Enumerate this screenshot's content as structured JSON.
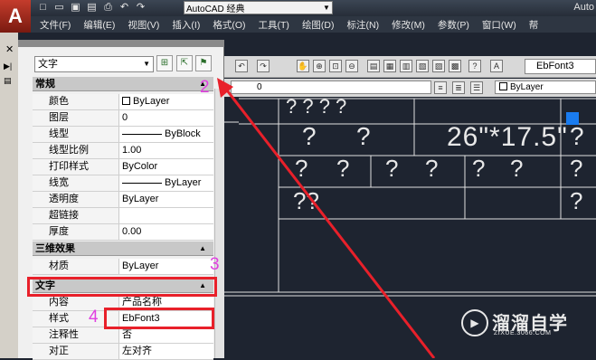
{
  "titlebar": {
    "logo": "A",
    "workspace": "AutoCAD 经典",
    "app_name": "Auto",
    "qa_icons": [
      "new-icon",
      "open-icon",
      "save-icon",
      "save-as-icon",
      "print-icon",
      "undo-icon",
      "redo-icon"
    ],
    "qa_glyphs": [
      "□",
      "▭",
      "▣",
      "▤",
      "⎙",
      "↶",
      "↷"
    ]
  },
  "menu": [
    "文件(F)",
    "编辑(E)",
    "视图(V)",
    "插入(I)",
    "格式(O)",
    "工具(T)",
    "绘图(D)",
    "标注(N)",
    "修改(M)",
    "参数(P)",
    "窗口(W)",
    "帮"
  ],
  "side": {
    "close": "✕",
    "pin": "▶|",
    "caption": "▤"
  },
  "toolbar": {
    "font_label": "EbFont3",
    "layer_value": "0",
    "bylayer": "ByLayer"
  },
  "properties": {
    "object_type": "文字",
    "section_general": "常规",
    "general_rows": [
      {
        "name": "颜色",
        "value": "ByLayer",
        "kind": "color"
      },
      {
        "name": "图层",
        "value": "0",
        "kind": "text"
      },
      {
        "name": "线型",
        "value": "ByBlock",
        "kind": "line"
      },
      {
        "name": "线型比例",
        "value": "1.00",
        "kind": "text"
      },
      {
        "name": "打印样式",
        "value": "ByColor",
        "kind": "text"
      },
      {
        "name": "线宽",
        "value": "ByLayer",
        "kind": "line"
      },
      {
        "name": "透明度",
        "value": "ByLayer",
        "kind": "text"
      },
      {
        "name": "超链接",
        "value": "",
        "kind": "text"
      },
      {
        "name": "厚度",
        "value": "0.00",
        "kind": "text"
      }
    ],
    "section_3d": "三维效果",
    "rows_3d": [
      {
        "name": "材质",
        "value": "ByLayer"
      }
    ],
    "section_text": "文字",
    "text_rows": [
      {
        "name": "内容",
        "value": "产品名称"
      },
      {
        "name": "样式",
        "value": "EbFont3"
      },
      {
        "name": "注释性",
        "value": "否"
      },
      {
        "name": "对正",
        "value": "左对齐"
      }
    ]
  },
  "annotations": {
    "n2": "2",
    "n3": "3",
    "n4": "4"
  },
  "drawing": {
    "t1": "? ? ? ?",
    "t2": "?",
    "t3": "?",
    "t4": "26\"*17.5\"",
    "t5": "?",
    "t6": "?",
    "t7": "?",
    "t8": "?",
    "t9": "?",
    "t10": "?",
    "t11": "?",
    "t12": "?",
    "t13": "??",
    "t14": "???",
    "t15": "?"
  },
  "watermark": {
    "title": "溜溜自学",
    "sub": "ZIXUE.3066.COM",
    "logo": "▶"
  }
}
